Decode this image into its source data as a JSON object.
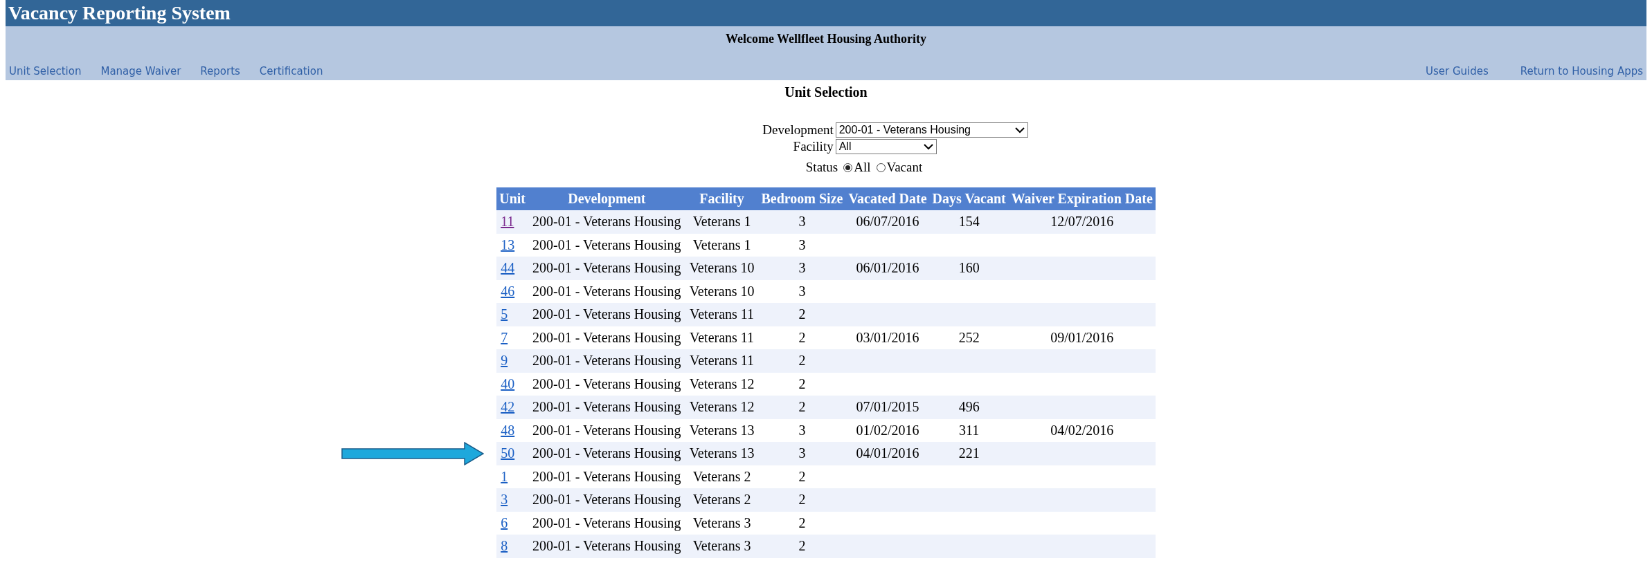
{
  "app_title": "Vacancy Reporting System",
  "welcome": "Welcome Wellfleet Housing Authority",
  "nav_left": [
    "Unit Selection",
    "Manage Waiver",
    "Reports",
    "Certification"
  ],
  "nav_right": [
    "User Guides",
    "Return to Housing Apps"
  ],
  "page_title": "Unit Selection",
  "filters": {
    "development": {
      "label": "Development",
      "value": "200-01 - Veterans Housing"
    },
    "facility": {
      "label": "Facility",
      "value": "All"
    },
    "status": {
      "label": "Status",
      "options": [
        {
          "label": "All",
          "selected": true
        },
        {
          "label": "Vacant",
          "selected": false
        }
      ]
    }
  },
  "table": {
    "columns": [
      "Unit",
      "Development",
      "Facility",
      "Bedroom Size",
      "Vacated Date",
      "Days Vacant",
      "Waiver Expiration Date"
    ],
    "rows": [
      {
        "visited": true,
        "pointer": false,
        "cells": [
          "11",
          "200-01 - Veterans Housing",
          "Veterans 1",
          "3",
          "06/07/2016",
          "154",
          "12/07/2016"
        ]
      },
      {
        "visited": false,
        "pointer": false,
        "cells": [
          "13",
          "200-01 - Veterans Housing",
          "Veterans 1",
          "3",
          "",
          "",
          ""
        ]
      },
      {
        "visited": false,
        "pointer": false,
        "cells": [
          "44",
          "200-01 - Veterans Housing",
          "Veterans 10",
          "3",
          "06/01/2016",
          "160",
          ""
        ]
      },
      {
        "visited": false,
        "pointer": false,
        "cells": [
          "46",
          "200-01 - Veterans Housing",
          "Veterans 10",
          "3",
          "",
          "",
          ""
        ]
      },
      {
        "visited": false,
        "pointer": false,
        "cells": [
          "5",
          "200-01 - Veterans Housing",
          "Veterans 11",
          "2",
          "",
          "",
          ""
        ]
      },
      {
        "visited": false,
        "pointer": false,
        "cells": [
          "7",
          "200-01 - Veterans Housing",
          "Veterans 11",
          "2",
          "03/01/2016",
          "252",
          "09/01/2016"
        ]
      },
      {
        "visited": false,
        "pointer": false,
        "cells": [
          "9",
          "200-01 - Veterans Housing",
          "Veterans 11",
          "2",
          "",
          "",
          ""
        ]
      },
      {
        "visited": false,
        "pointer": false,
        "cells": [
          "40",
          "200-01 - Veterans Housing",
          "Veterans 12",
          "2",
          "",
          "",
          ""
        ]
      },
      {
        "visited": false,
        "pointer": false,
        "cells": [
          "42",
          "200-01 - Veterans Housing",
          "Veterans 12",
          "2",
          "07/01/2015",
          "496",
          ""
        ]
      },
      {
        "visited": false,
        "pointer": false,
        "cells": [
          "48",
          "200-01 - Veterans Housing",
          "Veterans 13",
          "3",
          "01/02/2016",
          "311",
          "04/02/2016"
        ]
      },
      {
        "visited": false,
        "pointer": true,
        "cells": [
          "50",
          "200-01 - Veterans Housing",
          "Veterans 13",
          "3",
          "04/01/2016",
          "221",
          ""
        ]
      },
      {
        "visited": false,
        "pointer": false,
        "cells": [
          "1",
          "200-01 - Veterans Housing",
          "Veterans 2",
          "2",
          "",
          "",
          ""
        ]
      },
      {
        "visited": false,
        "pointer": false,
        "cells": [
          "3",
          "200-01 - Veterans Housing",
          "Veterans 2",
          "2",
          "",
          "",
          ""
        ]
      },
      {
        "visited": false,
        "pointer": false,
        "cells": [
          "6",
          "200-01 - Veterans Housing",
          "Veterans 3",
          "2",
          "",
          "",
          ""
        ]
      },
      {
        "visited": false,
        "pointer": false,
        "cells": [
          "8",
          "200-01 - Veterans Housing",
          "Veterans 3",
          "2",
          "",
          "",
          ""
        ]
      }
    ]
  }
}
